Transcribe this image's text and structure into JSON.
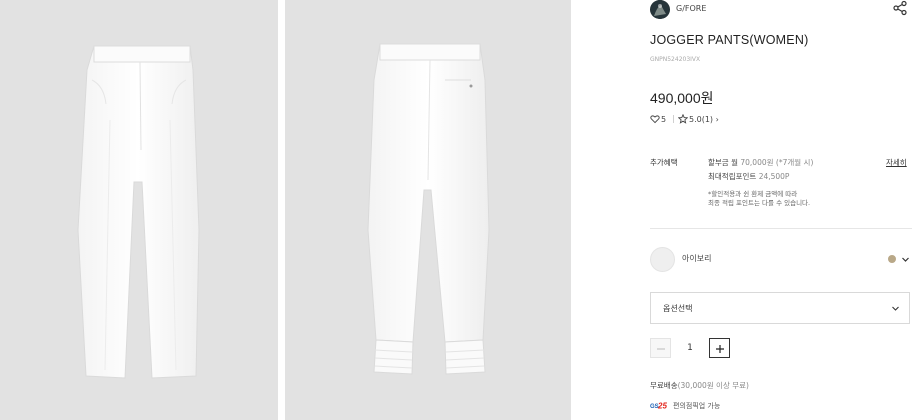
{
  "brand": {
    "name": "G/FORE"
  },
  "product": {
    "title": "JOGGER PANTS(WOMEN)",
    "code": "GNPN524203IVX",
    "price": "490,000원"
  },
  "stats": {
    "likes": "5",
    "separator": "|",
    "rating": "5.0(1)",
    "rating_arrow": "›"
  },
  "benefits": {
    "label": "추가혜택",
    "installment_prefix": "할부금 월 ",
    "installment_amount": "70,000원",
    "installment_suffix": " (*7개월 시)",
    "points_prefix": "최대적립포인트 ",
    "points_amount": "24,500P",
    "note_line1": "*할인적용과 쉰 환제 금액에 따라",
    "note_line2": "최종 적립 포인트는 다를 수 있습니다.",
    "detail_link": "자세히"
  },
  "color": {
    "name": "아이보리",
    "dot_color": "#b9a888"
  },
  "option_select": {
    "label": "옵션선택"
  },
  "quantity": {
    "value": "1"
  },
  "shipping": {
    "text": "무료배송",
    "condition": "(30,000원 이상 무료)"
  },
  "pickup": {
    "logo_text": "GS25",
    "text": "편의점픽업 가능"
  },
  "icons": {
    "share": "share-icon",
    "heart": "heart-icon",
    "star": "star-icon",
    "chevron": "chevron-down-icon",
    "minus": "minus-icon",
    "plus": "plus-icon"
  }
}
